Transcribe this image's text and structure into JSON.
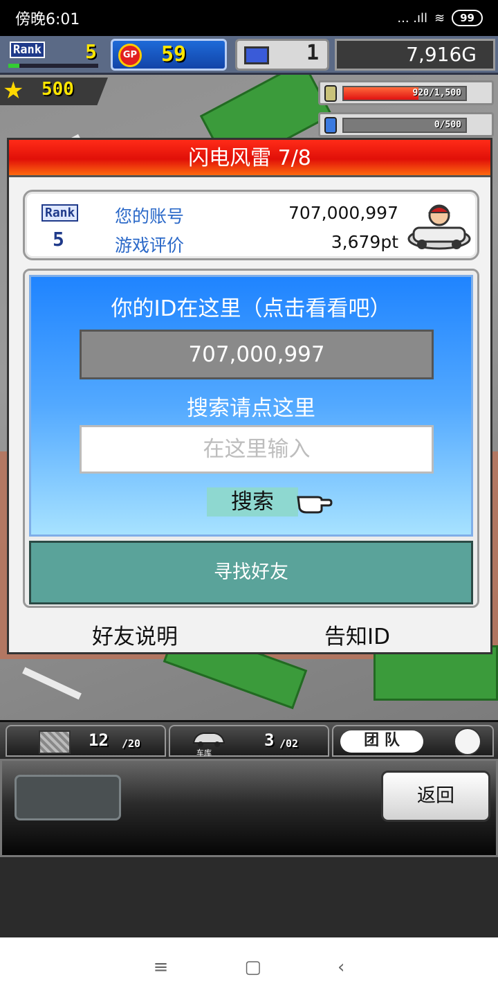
{
  "status_bar": {
    "time": "傍晚6:01",
    "signal": "... .ıll",
    "wifi": "≋",
    "battery": "99"
  },
  "hud": {
    "rank_label": "Rank",
    "rank_value": "5",
    "rank_progress": 0.12,
    "gp_icon": "GP",
    "gp_value": "59",
    "pc_value": "1",
    "gold": "7,916G",
    "star_value": "500",
    "resource1_text": "920/1,500",
    "resource1_fraction": 0.613,
    "resource2_text": "0/500",
    "resource2_fraction": 0
  },
  "dialog": {
    "title": "闪电风雷 7/8",
    "card": {
      "rank_label": "Rank",
      "rank_value": "5",
      "account_label": "您的账号",
      "account_value": "707,000,997",
      "rating_label": "游戏评价",
      "rating_value": "3,679pt"
    },
    "id_heading": "你的ID在这里（点击看看吧）",
    "id_value": "707,000,997",
    "search_heading": "搜索请点这里",
    "search_placeholder": "在这里输入",
    "search_button": "搜索",
    "find_friend_button": "寻找好友",
    "friend_help": "好友说明",
    "share_id": "告知ID"
  },
  "tab_bar": {
    "tab1_value": "12",
    "tab1_max": "/20",
    "tab2_label": "车库",
    "tab2_value": "3",
    "tab2_max": "/02",
    "tab3_label": "团 队"
  },
  "controls": {
    "back_button": "返回"
  },
  "nav_bar": {
    "menu_icon": "≡",
    "home_icon": "▢",
    "back_icon": "‹"
  },
  "colors": {
    "title_red": "#e01008",
    "panel_blue": "#1f84ff",
    "find_button": "#5aa39a",
    "gold_text": "#ffe600"
  }
}
